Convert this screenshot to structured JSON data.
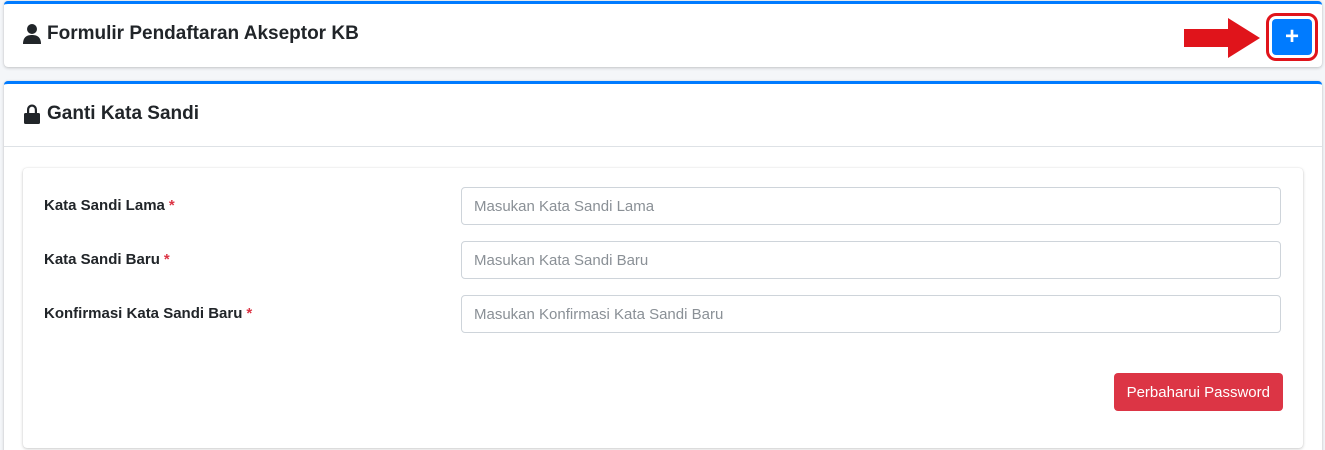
{
  "top_card": {
    "title": "Formulir Pendaftaran Akseptor KB",
    "title_icon": "user-icon",
    "add_button_label": "+",
    "annotation_color": "#e0141b"
  },
  "password_card": {
    "title": "Ganti Kata Sandi",
    "title_icon": "lock-icon",
    "required_marker": "*",
    "fields": [
      {
        "label": "Kata Sandi Lama",
        "placeholder": "Masukan Kata Sandi Lama",
        "value": ""
      },
      {
        "label": "Kata Sandi Baru",
        "placeholder": "Masukan Kata Sandi Baru",
        "value": ""
      },
      {
        "label": "Konfirmasi Kata Sandi Baru",
        "placeholder": "Masukan Konfirmasi Kata Sandi Baru",
        "value": ""
      }
    ],
    "submit_label": "Perbaharui Password"
  },
  "colors": {
    "primary": "#007bff",
    "danger": "#dc3545",
    "required": "#dc3545"
  }
}
